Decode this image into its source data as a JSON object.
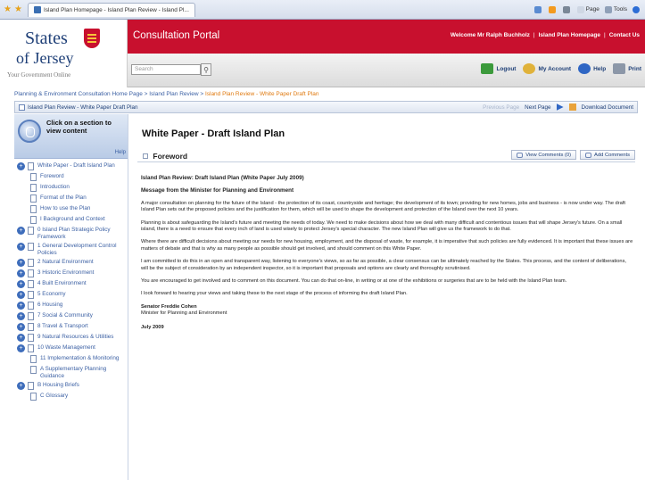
{
  "browser": {
    "tab_title": "Island Plan Homepage - Island Plan Review - Island Pl...",
    "tools": [
      "Page",
      "Tools"
    ]
  },
  "header": {
    "logo_states": "States",
    "logo_of": "of Jersey",
    "logo_tagline": "Your Government Online",
    "portal_title": "Consultation Portal",
    "welcome": "Welcome Mr Ralph Buchholz",
    "island_plan_link": "Island Plan Homepage",
    "contact_link": "Contact Us",
    "search_placeholder": "Search",
    "logout": "Logout",
    "my_account": "My Account",
    "help": "Help",
    "print": "Print"
  },
  "breadcrumb": {
    "item1": "Planning & Environment Consultation Home Page",
    "item2": "Island Plan Review",
    "current": "Island Plan Review - White Paper Draft Plan"
  },
  "doc_bar": {
    "title": "Island Plan Review - White Paper Draft Plan",
    "previous": "Previous Page",
    "next": "Next Page",
    "download": "Download Document"
  },
  "sidebar": {
    "heading": "Click on a section to view content",
    "help": "Help",
    "items": [
      {
        "label": "White Paper - Draft Island Plan",
        "type": "top"
      },
      {
        "label": "Foreword",
        "type": "sub"
      },
      {
        "label": "Introduction",
        "type": "sub"
      },
      {
        "label": "Format of the Plan",
        "type": "sub"
      },
      {
        "label": "How to use the Plan",
        "type": "sub"
      },
      {
        "label": "I Background and Context",
        "type": "sub"
      },
      {
        "label": "0 Island Plan Strategic Policy Framework",
        "type": "top"
      },
      {
        "label": "1 General Development Control Policies",
        "type": "top"
      },
      {
        "label": "2 Natural Environment",
        "type": "top"
      },
      {
        "label": "3 Historic Environment",
        "type": "top"
      },
      {
        "label": "4 Built Environment",
        "type": "top"
      },
      {
        "label": "5 Economy",
        "type": "top"
      },
      {
        "label": "6 Housing",
        "type": "top"
      },
      {
        "label": "7 Social & Community",
        "type": "top"
      },
      {
        "label": "8 Travel & Transport",
        "type": "top"
      },
      {
        "label": "9 Natural Resources & Utilities",
        "type": "top"
      },
      {
        "label": "10 Waste Management",
        "type": "top"
      },
      {
        "label": "11 Implementation & Monitoring",
        "type": "sub"
      },
      {
        "label": "A Supplementary Planning Guidance",
        "type": "sub"
      },
      {
        "label": "B Housing Briefs",
        "type": "top"
      },
      {
        "label": "C Glossary",
        "type": "sub"
      }
    ]
  },
  "main": {
    "title": "White Paper - Draft Island Plan",
    "section": "Foreword",
    "view_comments": "View Comments (0)",
    "add_comments": "Add Comments",
    "doc_heading": "Island Plan Review: Draft Island Plan (White Paper July 2009)",
    "doc_subheading": "Message from the Minister for Planning and Environment",
    "p1": "A major consultation on planning for the future of the Island - the protection of its coast, countryside and heritage; the development of its town; providing for new homes, jobs and business - is now under way. The draft Island Plan sets out the proposed policies and the justification for them, which will be used to shape the development and protection of the Island over the next 10 years.",
    "p2": "Planning is about safeguarding the Island's future and meeting the needs of today. We need to make decisions about how we deal with many difficult and contentious issues that will shape Jersey's future. On a small island, there is a need to ensure that every inch of land is used wisely to protect Jersey's special character. The new Island Plan will give us the framework to do that.",
    "p3": "Where there are difficult decisions about meeting our needs for new housing, employment, and the disposal of waste, for example, it is imperative that such policies are fully evidenced. It is important that these issues are matters of debate and that is why as many people as possible should get involved, and should comment on this White Paper.",
    "p4": "I am committed to do this in an open and transparent way, listening to everyone's views, so as far as possible, a clear consensus can be ultimately reached by the States. This process, and the content of deliberations, will be the subject of consideration by an independent inspector, so it is important that proposals and options are clearly and thoroughly scrutinised.",
    "p5": "You are encouraged to get involved and to comment on this document. You can do that on-line, in writing or at one of the exhibitions or surgeries that are to be held with the Island Plan team.",
    "p6": "I look forward to hearing your views and taking these to the next stage of the process of informing the draft Island Plan.",
    "signature_name": "Senator Freddie Cohen",
    "signature_role": "Minister for Planning and Environment",
    "date": "July 2009"
  }
}
